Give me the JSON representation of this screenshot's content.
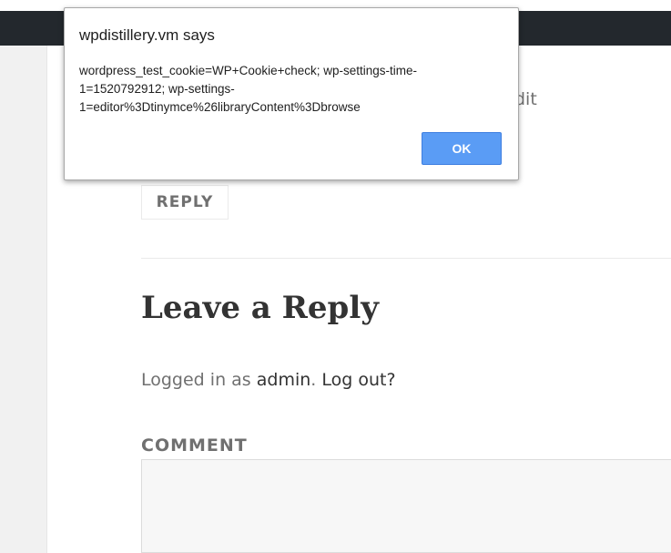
{
  "dialog": {
    "title": "wpdistillery.vm says",
    "message": "wordpress_test_cookie=WP+Cookie+check; wp-settings-time-1=1520792912; wp-settings-1=editor%3Dtinymce%26libraryContent%3Dbrowse",
    "ok_label": "OK",
    "ok_color": "#5a9cf5"
  },
  "page": {
    "edit_partial": "dit",
    "reply_button": "REPLY",
    "reply_title": "Leave a Reply",
    "logged_in_prefix": "Logged in as",
    "user_name": "admin",
    "separator": ".",
    "logout_label": "Log out?",
    "comment_label": "COMMENT",
    "comment_value": ""
  },
  "colors": {
    "admin_bar": "#23282d",
    "text_muted": "#707070",
    "text_dark": "#333333"
  }
}
